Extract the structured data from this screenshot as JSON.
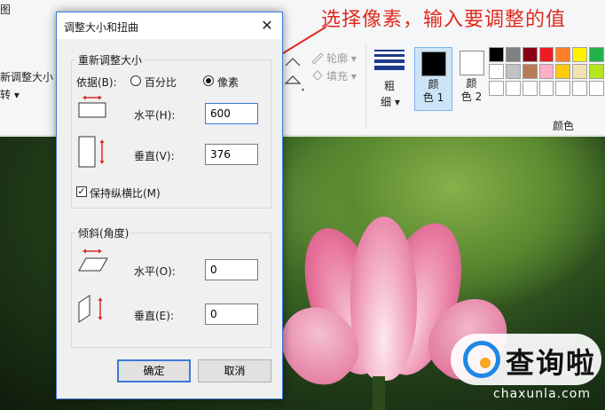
{
  "ribbon": {
    "left_labels": [
      "图",
      "新调整大小",
      "转 ▾"
    ],
    "outline_label": "轮廓 ▾",
    "fill_label": "填充 ▾",
    "size_label_1": "粗",
    "size_label_2": "细 ▾",
    "color1_label_1": "颜",
    "color1_label_2": "色 1",
    "color2_label_1": "颜",
    "color2_label_2": "色 2",
    "colors_group_label": "颜色",
    "color1_value": "#000000",
    "color2_value": "#ffffff",
    "palette": [
      [
        "#000000",
        "#7f7f7f",
        "#880015",
        "#ed1c24",
        "#ff7f27",
        "#fff200",
        "#22b14c"
      ],
      [
        "#ffffff",
        "#c3c3c3",
        "#b97a57",
        "#ffaec9",
        "#ffc90e",
        "#efe4b0",
        "#b5e61d"
      ],
      [
        "#ffffff",
        "#ffffff",
        "#ffffff",
        "#ffffff",
        "#ffffff",
        "#ffffff",
        "#ffffff"
      ]
    ]
  },
  "annotation": {
    "text": "选择像素，输入要调整的值",
    "color": "#e0291f"
  },
  "dialog": {
    "title": "调整大小和扭曲",
    "close_symbol": "✕",
    "resize_group": {
      "title": "重新调整大小",
      "by_label": "依据(B):",
      "percent_label": "百分比",
      "pixels_label": "像素",
      "selected": "pixels",
      "horizontal_label": "水平(H):",
      "horizontal_value": "600",
      "vertical_label": "垂直(V):",
      "vertical_value": "376",
      "keep_ratio_label": "保持纵横比(M)",
      "keep_ratio_checked": true
    },
    "skew_group": {
      "title": "倾斜(角度)",
      "horizontal_label": "水平(O):",
      "horizontal_value": "0",
      "vertical_label": "垂直(E):",
      "vertical_value": "0"
    },
    "ok_label": "确定",
    "cancel_label": "取消"
  },
  "watermark": {
    "name": "查询啦",
    "url": "chaxunla.com"
  }
}
